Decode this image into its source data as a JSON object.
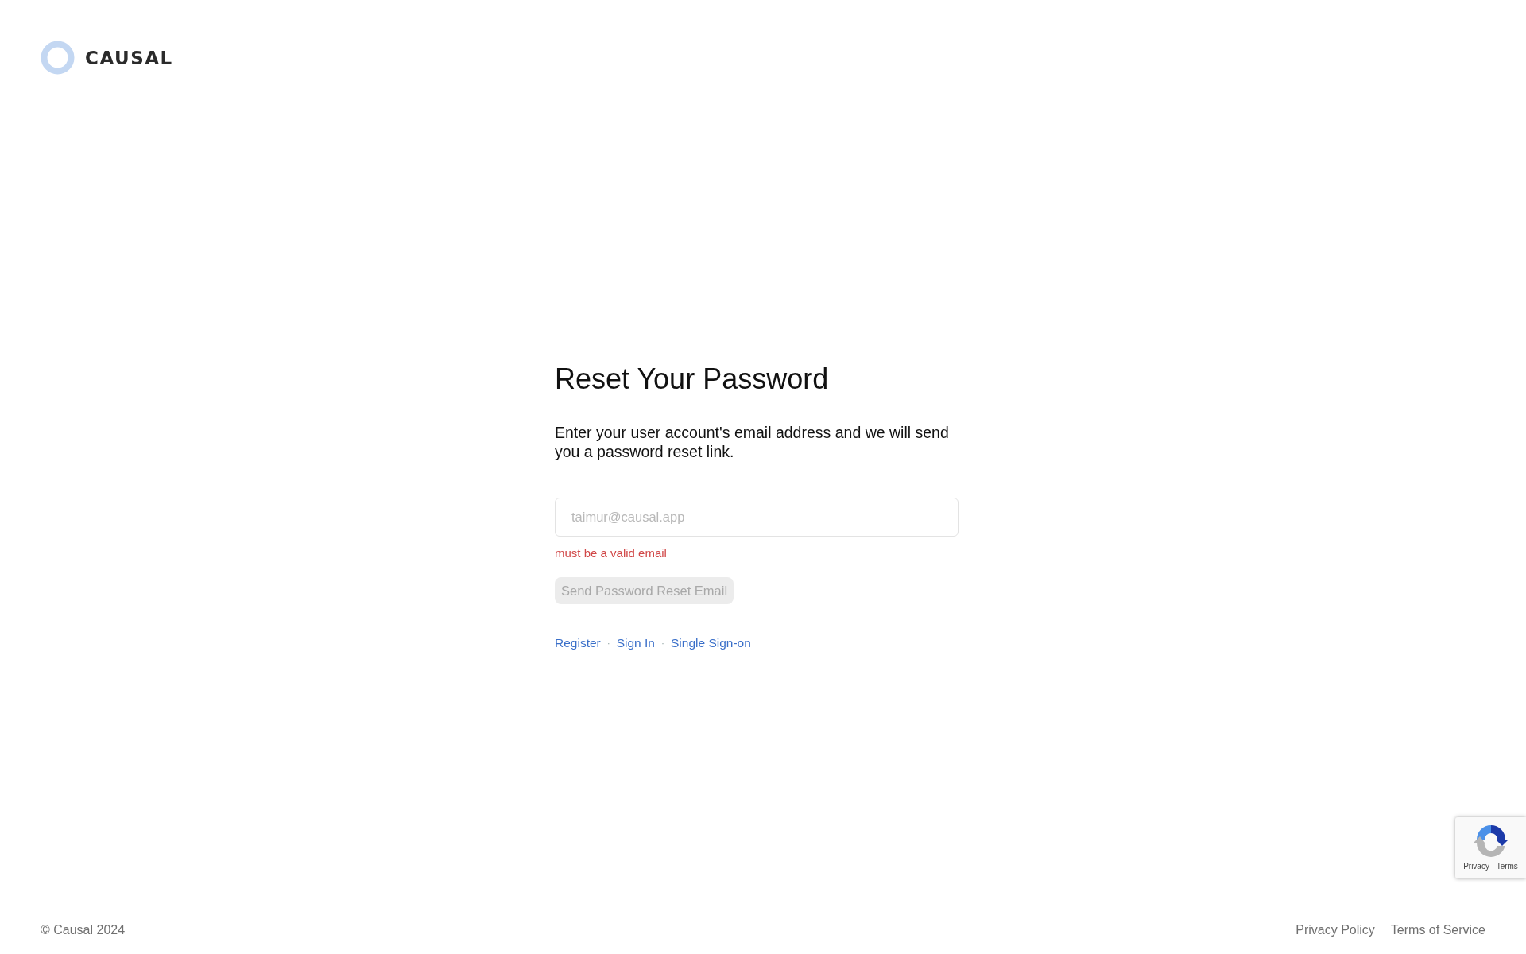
{
  "header": {
    "logo_text": "CAUSAL"
  },
  "form": {
    "title": "Reset Your Password",
    "description": "Enter your user account's email address and we will send you a password reset link.",
    "email_field": {
      "placeholder": "taimur@causal.app"
    },
    "error": "must be a valid email",
    "submit_button": {
      "label": "Send Password Reset Email",
      "disabled": true
    },
    "links": [
      {
        "label": "Register"
      },
      {
        "label": "Sign In"
      },
      {
        "label": "Single Sign-on"
      }
    ],
    "link_separator": "·"
  },
  "footer": {
    "copyright": "© Causal 2024",
    "links": [
      {
        "label": "Privacy Policy"
      },
      {
        "label": "Terms of Service"
      }
    ]
  },
  "recaptcha_badge": {
    "text": "Privacy - Terms"
  }
}
